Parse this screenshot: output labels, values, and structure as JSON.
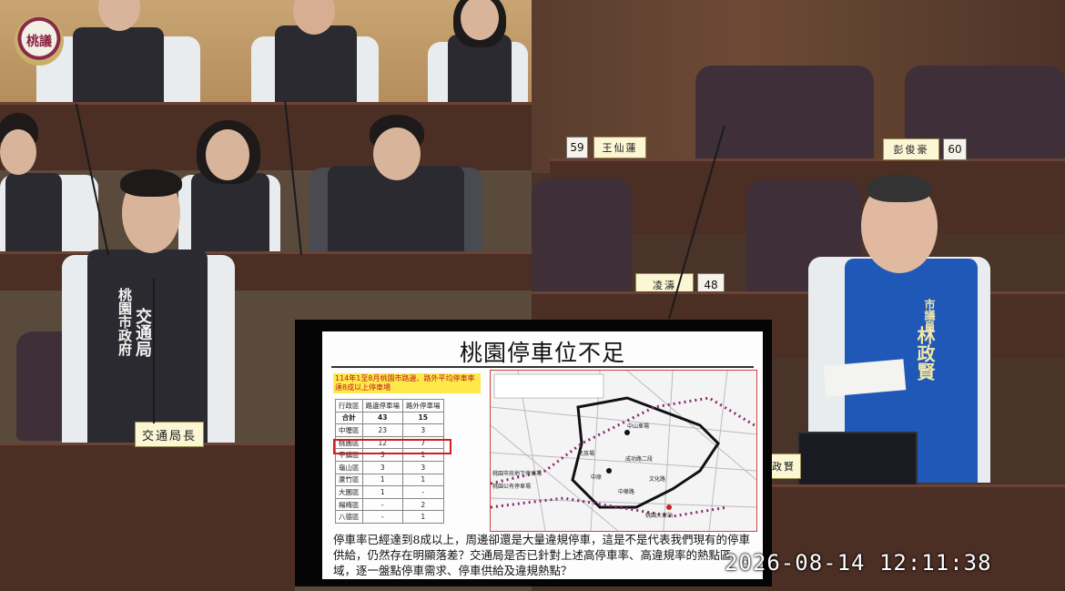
{
  "logo": {
    "text": "桃議"
  },
  "left_feed": {
    "official_badge": {
      "line1": "桃園市政府",
      "line2": "交通局"
    },
    "official_nameplate": "交通局長"
  },
  "right_feed": {
    "councilor_sash": {
      "title": "市議員",
      "name": "林政賢"
    },
    "seat_numbers": [
      "59",
      "60",
      "48"
    ],
    "nameplates": [
      "王仙蓮",
      "彭俊豪",
      "凌濤"
    ],
    "partial_nameplate": "政賢"
  },
  "slide": {
    "title": "桃園停車位不足",
    "table_caption": "114年1至8月桃園市路邊、路外平均停車率達8成以上停車場",
    "table": {
      "headers": [
        "行政區",
        "路邊停車場",
        "路外停車場"
      ],
      "rows": [
        [
          "合計",
          "43",
          "15"
        ],
        [
          "中壢區",
          "23",
          "3"
        ],
        [
          "桃園區",
          "12",
          "7"
        ],
        [
          "平鎮區",
          "3",
          "1"
        ],
        [
          "龜山區",
          "3",
          "3"
        ],
        [
          "蘆竹區",
          "1",
          "1"
        ],
        [
          "大園區",
          "1",
          "-"
        ],
        [
          "楊梅區",
          "-",
          "2"
        ],
        [
          "八德區",
          "-",
          "1"
        ]
      ],
      "highlighted_row": "桃園區"
    },
    "map_labels": [
      "中山車場",
      "民族場",
      "成功路二段",
      "中原",
      "中華路",
      "文化路",
      "桃園火車站",
      "桃園市府地下停車場",
      "桃園公有停車場"
    ],
    "body": "停車率已經達到8成以上，周邊卻還是大量違規停車，這是不是代表我們現有的停車供給，仍然存在明顯落差？交通局是否已針對上述高停車率、高違規率的熱點區域，逐一盤點停車需求、停車供給及違規熱點？"
  },
  "timestamp": "2026-08-14  12:11:38",
  "colors": {
    "slide_bg": "#fdfdfd",
    "caption_highlight": "#ffe94a",
    "table_highlight": "#d21f1f",
    "route_line": "#8a2a6a",
    "councilor_vest": "#2058b8"
  }
}
